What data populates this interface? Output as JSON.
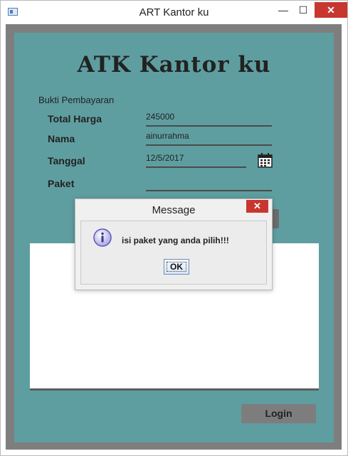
{
  "window": {
    "title": "ART Kantor ku",
    "minimize_glyph": "—",
    "maximize_glyph": "☐",
    "close_glyph": "✕",
    "icon": "app-window-icon"
  },
  "form": {
    "heading": "ATK Kantor ku",
    "subtitle": "Bukti Pembayaran",
    "fields": {
      "total_harga": {
        "label": "Total Harga",
        "value": "245000"
      },
      "nama": {
        "label": "Nama",
        "value": "ainurrahma"
      },
      "tanggal": {
        "label": "Tanggal",
        "value": "12/5/2017",
        "icon": "calendar-icon"
      },
      "paket": {
        "label": "Paket",
        "value": ""
      }
    },
    "login_label": "Login"
  },
  "dialog": {
    "title": "Message",
    "close_glyph": "✕",
    "icon": "info-icon",
    "message": "isi paket yang anda pilih!!!",
    "ok_label": "OK"
  },
  "colors": {
    "teal_panel": "#5f9ea0",
    "frame_gray": "#7e7e7e",
    "close_red": "#c7372f"
  }
}
